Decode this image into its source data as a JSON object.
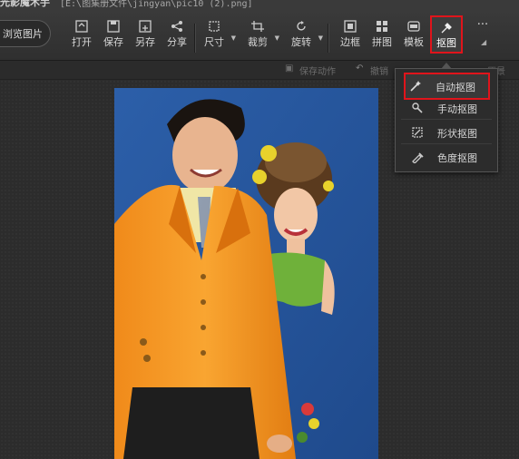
{
  "app": {
    "title": "光影魔术手",
    "file_path": "[E:\\图集册文件\\jingyan\\pic10 (2).png]"
  },
  "toolbar": {
    "browse_label": "浏览图片",
    "tools": [
      {
        "label": "打开",
        "icon": "open-icon"
      },
      {
        "label": "保存",
        "icon": "save-icon"
      },
      {
        "label": "另存",
        "icon": "save-as-icon"
      },
      {
        "label": "分享",
        "icon": "share-icon"
      },
      {
        "label": "尺寸",
        "icon": "resize-icon"
      },
      {
        "label": "裁剪",
        "icon": "crop-icon"
      },
      {
        "label": "旋转",
        "icon": "rotate-icon"
      },
      {
        "label": "边框",
        "icon": "border-icon"
      },
      {
        "label": "拼图",
        "icon": "collage-icon"
      },
      {
        "label": "模板",
        "icon": "template-icon"
      },
      {
        "label": "抠图",
        "icon": "cutout-icon"
      }
    ],
    "more_label": "···"
  },
  "subbar": {
    "save_action": "保存动作",
    "undo": "撤销",
    "restore": "原景"
  },
  "cutout_menu": {
    "items": [
      {
        "label": "自动抠图",
        "icon": "magic-wand-icon"
      },
      {
        "label": "手动抠图",
        "icon": "hand-brush-icon"
      },
      {
        "label": "形状抠图",
        "icon": "shape-icon"
      },
      {
        "label": "色度抠图",
        "icon": "color-pick-icon"
      }
    ]
  },
  "colors": {
    "highlight_border": "#e0141b",
    "photo_bg": "#2f63a8"
  }
}
